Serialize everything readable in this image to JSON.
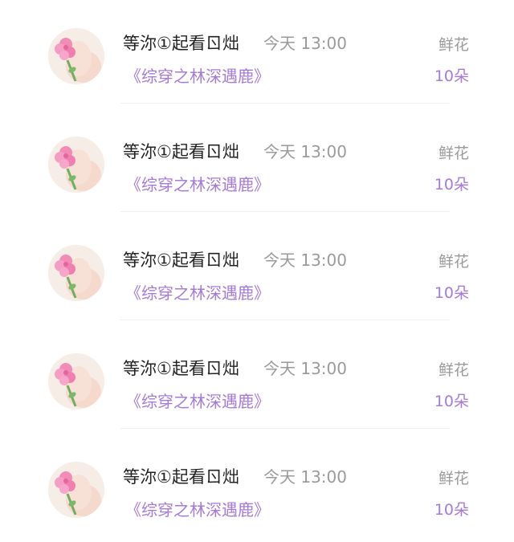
{
  "records": [
    {
      "name": "等沵①起看ㄖ炪",
      "time": "今天 13:00",
      "book": "《综穿之林深遇鹿》",
      "gift": "鲜花",
      "count": "10朵",
      "avatar_icon": "rose-bouquet-avatar"
    },
    {
      "name": "等沵①起看ㄖ炪",
      "time": "今天 13:00",
      "book": "《综穿之林深遇鹿》",
      "gift": "鲜花",
      "count": "10朵",
      "avatar_icon": "rose-bouquet-avatar"
    },
    {
      "name": "等沵①起看ㄖ炪",
      "time": "今天 13:00",
      "book": "《综穿之林深遇鹿》",
      "gift": "鲜花",
      "count": "10朵",
      "avatar_icon": "rose-bouquet-avatar"
    },
    {
      "name": "等沵①起看ㄖ炪",
      "time": "今天 13:00",
      "book": "《综穿之林深遇鹿》",
      "gift": "鲜花",
      "count": "10朵",
      "avatar_icon": "rose-bouquet-avatar"
    },
    {
      "name": "等沵①起看ㄖ炪",
      "time": "今天 13:00",
      "book": "《综穿之林深遇鹿》",
      "gift": "鲜花",
      "count": "10朵",
      "avatar_icon": "rose-bouquet-avatar"
    }
  ],
  "colors": {
    "accent_purple": "#a57ad8",
    "name_text": "#222222",
    "muted_text": "#9a9a9a",
    "divider": "#f0f0f0",
    "rose_pink": "#f28bb6",
    "leaf_green": "#6fae5e"
  }
}
